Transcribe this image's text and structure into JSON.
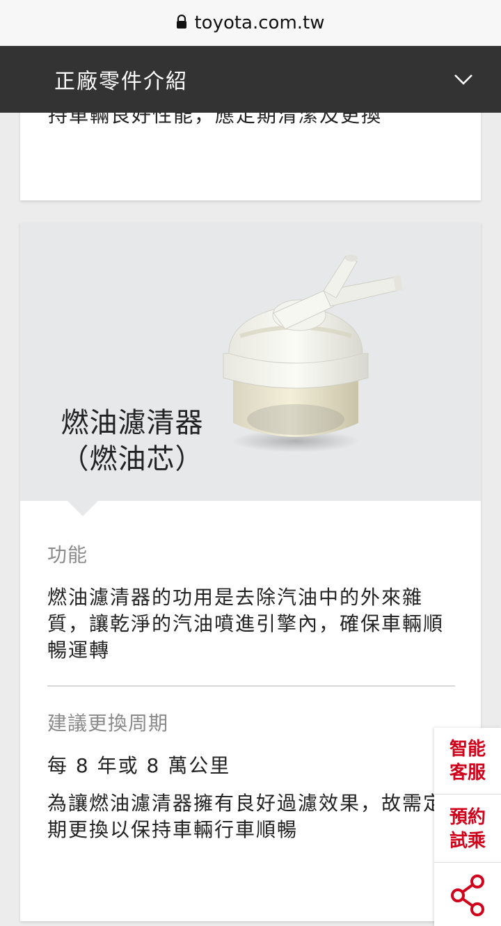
{
  "browser": {
    "url": "toyota.com.tw"
  },
  "header": {
    "title": "正廠零件介紹"
  },
  "prev_card": {
    "text": "持車輛良好性能，應定期清潔及更換"
  },
  "part": {
    "name_line1": "燃油濾清器",
    "name_line2": "（燃油芯）",
    "function_label": "功能",
    "function_text": "燃油濾清器的功用是去除汽油中的外來雜質，讓乾淨的汽油噴進引擎內，確保車輛順暢運轉",
    "interval_label": "建議更換周期",
    "interval_value": "每 8 年或 8 萬公里",
    "interval_note": "為讓燃油濾清器擁有良好過濾效果，故需定期更換以保持車輛行車順暢"
  },
  "side_buttons": {
    "service_label": "智能客服",
    "testdrive_label": "預約試乘"
  },
  "colors": {
    "header_bg": "#333333",
    "accent": "#d0021b",
    "hero_bg": "#e6e8ea"
  }
}
